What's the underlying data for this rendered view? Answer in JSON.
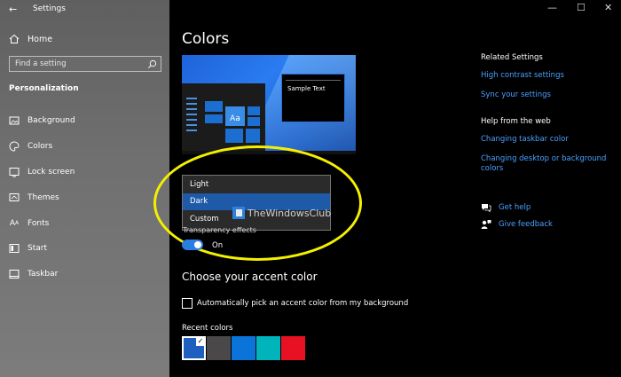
{
  "window": {
    "title": "Settings",
    "back_icon": "back-arrow-icon",
    "controls": [
      "—",
      "☐",
      "✕"
    ]
  },
  "sidebar": {
    "home_label": "Home",
    "search_placeholder": "Find a setting",
    "section_title": "Personalization",
    "items": [
      {
        "label": "Background",
        "icon": "picture-icon"
      },
      {
        "label": "Colors",
        "icon": "palette-icon"
      },
      {
        "label": "Lock screen",
        "icon": "lock-screen-icon"
      },
      {
        "label": "Themes",
        "icon": "themes-icon"
      },
      {
        "label": "Fonts",
        "icon": "fonts-icon"
      },
      {
        "label": "Start",
        "icon": "start-icon"
      },
      {
        "label": "Taskbar",
        "icon": "taskbar-icon"
      }
    ]
  },
  "main": {
    "title": "Colors",
    "preview": {
      "sample_text": "Sample Text",
      "tile_text": "Aa"
    },
    "color_mode_options": [
      "Light",
      "Dark",
      "Custom"
    ],
    "color_mode_selected": "Dark",
    "transparency_label": "Transparency effects",
    "transparency_state": "On",
    "accent_title": "Choose your accent color",
    "auto_accent_label": "Automatically pick an accent color from my background",
    "recent_colors_label": "Recent colors",
    "recent_colors": [
      "#1e5fbf",
      "#4a4848",
      "#0a74d8",
      "#00b4bc",
      "#e81123"
    ],
    "recent_selected_index": 0
  },
  "watermark_text": "TheWindowsClub",
  "annotation_color": "#f4f000",
  "right": {
    "related_title": "Related Settings",
    "related_links": [
      "High contrast settings",
      "Sync your settings"
    ],
    "help_title": "Help from the web",
    "help_links": [
      "Changing taskbar color",
      "Changing desktop or background colors"
    ],
    "get_help": "Get help",
    "give_feedback": "Give feedback"
  },
  "colors": {
    "accent": "#2a7de1",
    "link": "#4aa0ff",
    "dropdown_selected": "#1e5aa8"
  }
}
